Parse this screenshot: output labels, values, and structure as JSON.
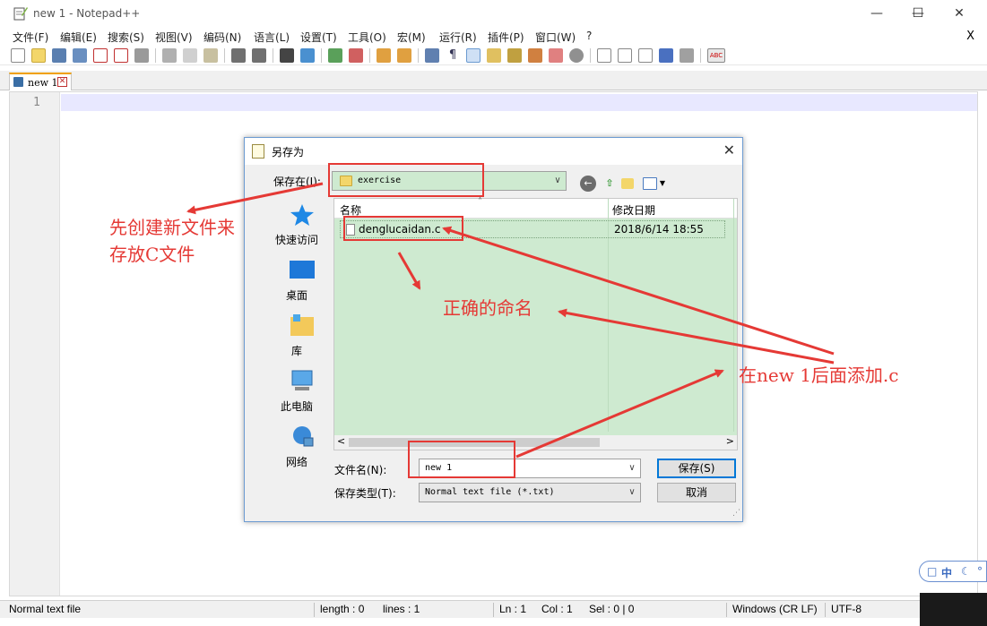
{
  "window": {
    "title": "new 1 - Notepad++"
  },
  "menu": [
    "文件(F)",
    "编辑(E)",
    "搜索(S)",
    "视图(V)",
    "编码(N)",
    "语言(L)",
    "设置(T)",
    "工具(O)",
    "宏(M)",
    "运行(R)",
    "插件(P)",
    "窗口(W)",
    "?"
  ],
  "menu_close": "X",
  "tab": {
    "label": "new 1"
  },
  "editor": {
    "line_number": "1"
  },
  "status": {
    "file_type": "Normal text file",
    "length": "length : 0",
    "lines": "lines : 1",
    "ln": "Ln : 1",
    "col": "Col : 1",
    "sel": "Sel : 0 | 0",
    "eol": "Windows (CR LF)",
    "encoding": "UTF-8"
  },
  "ime": {
    "lang": "中"
  },
  "dialog": {
    "title": "另存为",
    "save_in_label": "保存在(I):",
    "folder": "exercise",
    "places": [
      "快速访问",
      "桌面",
      "库",
      "此电脑",
      "网络"
    ],
    "columns": {
      "name": "名称",
      "modified": "修改日期"
    },
    "files": [
      {
        "name": "denglucaidan.c",
        "modified": "2018/6/14 18:55"
      }
    ],
    "filename_label": "文件名(N):",
    "filename": "new 1",
    "filetype_label": "保存类型(T):",
    "filetype": "Normal text file (*.txt)",
    "save_button": "保存(S)",
    "cancel_button": "取消"
  },
  "annotations": {
    "create_folder": "先创建新文件来",
    "create_folder_2": "存放C文件",
    "correct_name": "正确的命名",
    "append_c": "在new 1后面添加.c"
  },
  "colors": {
    "annotation": "#e53935",
    "list_bg": "#ceead0",
    "accent": "#0078d7"
  }
}
